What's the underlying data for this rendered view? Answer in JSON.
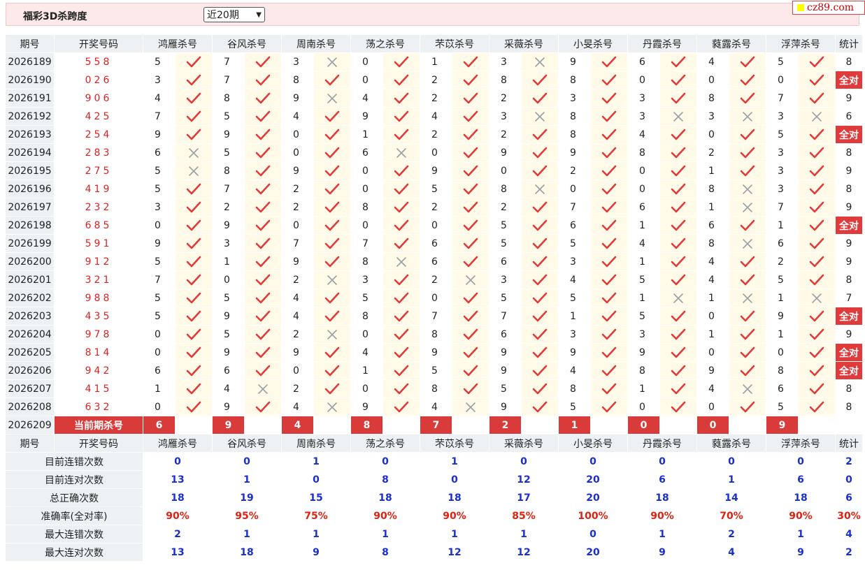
{
  "header": {
    "title": "福彩3D杀跨度",
    "period_selected": "近20期",
    "logo_text": "cz89.com"
  },
  "columns": {
    "issue": "期号",
    "numbers": "开奖号码",
    "experts": [
      "鸿雁杀号",
      "谷风杀号",
      "周南杀号",
      "荡之杀号",
      "芣苡杀号",
      "采薇杀号",
      "小旻杀号",
      "丹霞杀号",
      "蕤露杀号",
      "浮萍杀号"
    ],
    "stat": "统计"
  },
  "rows": [
    {
      "issue": "2026189",
      "numbers": "558",
      "kills": [
        [
          "5",
          1
        ],
        [
          "7",
          1
        ],
        [
          "3",
          0
        ],
        [
          "0",
          1
        ],
        [
          "1",
          1
        ],
        [
          "3",
          0
        ],
        [
          "9",
          1
        ],
        [
          "6",
          1
        ],
        [
          "4",
          1
        ],
        [
          "5",
          1
        ]
      ],
      "stat": "8"
    },
    {
      "issue": "2026190",
      "numbers": "026",
      "kills": [
        [
          "3",
          1
        ],
        [
          "7",
          1
        ],
        [
          "8",
          1
        ],
        [
          "0",
          1
        ],
        [
          "2",
          1
        ],
        [
          "8",
          1
        ],
        [
          "8",
          1
        ],
        [
          "0",
          1
        ],
        [
          "0",
          1
        ],
        [
          "0",
          1
        ]
      ],
      "stat": "全对"
    },
    {
      "issue": "2026191",
      "numbers": "906",
      "kills": [
        [
          "4",
          1
        ],
        [
          "8",
          1
        ],
        [
          "9",
          0
        ],
        [
          "4",
          1
        ],
        [
          "2",
          1
        ],
        [
          "2",
          1
        ],
        [
          "3",
          1
        ],
        [
          "3",
          1
        ],
        [
          "8",
          1
        ],
        [
          "7",
          1
        ]
      ],
      "stat": "9"
    },
    {
      "issue": "2026192",
      "numbers": "425",
      "kills": [
        [
          "7",
          1
        ],
        [
          "5",
          1
        ],
        [
          "4",
          1
        ],
        [
          "9",
          1
        ],
        [
          "4",
          1
        ],
        [
          "3",
          0
        ],
        [
          "8",
          1
        ],
        [
          "3",
          0
        ],
        [
          "3",
          0
        ],
        [
          "3",
          0
        ]
      ],
      "stat": "6"
    },
    {
      "issue": "2026193",
      "numbers": "254",
      "kills": [
        [
          "9",
          1
        ],
        [
          "9",
          1
        ],
        [
          "0",
          1
        ],
        [
          "1",
          1
        ],
        [
          "2",
          1
        ],
        [
          "2",
          1
        ],
        [
          "8",
          1
        ],
        [
          "4",
          1
        ],
        [
          "0",
          1
        ],
        [
          "5",
          1
        ]
      ],
      "stat": "全对"
    },
    {
      "issue": "2026194",
      "numbers": "283",
      "kills": [
        [
          "6",
          0
        ],
        [
          "5",
          1
        ],
        [
          "0",
          1
        ],
        [
          "6",
          0
        ],
        [
          "0",
          1
        ],
        [
          "9",
          1
        ],
        [
          "9",
          1
        ],
        [
          "8",
          1
        ],
        [
          "2",
          1
        ],
        [
          "3",
          1
        ]
      ],
      "stat": "8"
    },
    {
      "issue": "2026195",
      "numbers": "275",
      "kills": [
        [
          "5",
          0
        ],
        [
          "8",
          1
        ],
        [
          "9",
          1
        ],
        [
          "0",
          1
        ],
        [
          "9",
          1
        ],
        [
          "0",
          1
        ],
        [
          "2",
          1
        ],
        [
          "0",
          1
        ],
        [
          "1",
          1
        ],
        [
          "3",
          1
        ]
      ],
      "stat": "9"
    },
    {
      "issue": "2026196",
      "numbers": "419",
      "kills": [
        [
          "5",
          1
        ],
        [
          "7",
          1
        ],
        [
          "2",
          1
        ],
        [
          "0",
          1
        ],
        [
          "5",
          1
        ],
        [
          "8",
          0
        ],
        [
          "0",
          1
        ],
        [
          "0",
          1
        ],
        [
          "8",
          0
        ],
        [
          "3",
          1
        ]
      ],
      "stat": "8"
    },
    {
      "issue": "2026197",
      "numbers": "232",
      "kills": [
        [
          "3",
          1
        ],
        [
          "2",
          1
        ],
        [
          "2",
          1
        ],
        [
          "8",
          1
        ],
        [
          "2",
          1
        ],
        [
          "2",
          1
        ],
        [
          "7",
          1
        ],
        [
          "6",
          1
        ],
        [
          "1",
          0
        ],
        [
          "7",
          1
        ]
      ],
      "stat": "9"
    },
    {
      "issue": "2026198",
      "numbers": "685",
      "kills": [
        [
          "0",
          1
        ],
        [
          "9",
          1
        ],
        [
          "0",
          1
        ],
        [
          "0",
          1
        ],
        [
          "0",
          1
        ],
        [
          "5",
          1
        ],
        [
          "6",
          1
        ],
        [
          "1",
          1
        ],
        [
          "6",
          1
        ],
        [
          "1",
          1
        ]
      ],
      "stat": "全对"
    },
    {
      "issue": "2026199",
      "numbers": "591",
      "kills": [
        [
          "9",
          1
        ],
        [
          "3",
          1
        ],
        [
          "7",
          1
        ],
        [
          "7",
          1
        ],
        [
          "6",
          1
        ],
        [
          "5",
          1
        ],
        [
          "5",
          1
        ],
        [
          "4",
          1
        ],
        [
          "8",
          0
        ],
        [
          "6",
          1
        ]
      ],
      "stat": "9"
    },
    {
      "issue": "2026200",
      "numbers": "912",
      "kills": [
        [
          "5",
          1
        ],
        [
          "1",
          1
        ],
        [
          "9",
          1
        ],
        [
          "8",
          0
        ],
        [
          "6",
          1
        ],
        [
          "6",
          1
        ],
        [
          "3",
          1
        ],
        [
          "1",
          1
        ],
        [
          "4",
          1
        ],
        [
          "2",
          1
        ]
      ],
      "stat": "9"
    },
    {
      "issue": "2026201",
      "numbers": "321",
      "kills": [
        [
          "7",
          1
        ],
        [
          "0",
          1
        ],
        [
          "2",
          0
        ],
        [
          "3",
          1
        ],
        [
          "2",
          0
        ],
        [
          "3",
          1
        ],
        [
          "4",
          1
        ],
        [
          "5",
          1
        ],
        [
          "4",
          1
        ],
        [
          "5",
          1
        ]
      ],
      "stat": "8"
    },
    {
      "issue": "2026202",
      "numbers": "988",
      "kills": [
        [
          "5",
          1
        ],
        [
          "5",
          1
        ],
        [
          "4",
          1
        ],
        [
          "5",
          1
        ],
        [
          "0",
          1
        ],
        [
          "5",
          1
        ],
        [
          "5",
          1
        ],
        [
          "1",
          0
        ],
        [
          "1",
          0
        ],
        [
          "1",
          0
        ]
      ],
      "stat": "7"
    },
    {
      "issue": "2026203",
      "numbers": "435",
      "kills": [
        [
          "5",
          1
        ],
        [
          "9",
          1
        ],
        [
          "4",
          1
        ],
        [
          "8",
          1
        ],
        [
          "7",
          1
        ],
        [
          "7",
          1
        ],
        [
          "1",
          1
        ],
        [
          "5",
          1
        ],
        [
          "0",
          1
        ],
        [
          "9",
          1
        ]
      ],
      "stat": "全对"
    },
    {
      "issue": "2026204",
      "numbers": "978",
      "kills": [
        [
          "0",
          1
        ],
        [
          "5",
          1
        ],
        [
          "2",
          0
        ],
        [
          "0",
          1
        ],
        [
          "8",
          1
        ],
        [
          "6",
          1
        ],
        [
          "3",
          1
        ],
        [
          "3",
          1
        ],
        [
          "1",
          1
        ],
        [
          "1",
          1
        ]
      ],
      "stat": "9"
    },
    {
      "issue": "2026205",
      "numbers": "814",
      "kills": [
        [
          "0",
          1
        ],
        [
          "9",
          1
        ],
        [
          "9",
          1
        ],
        [
          "4",
          1
        ],
        [
          "9",
          1
        ],
        [
          "9",
          1
        ],
        [
          "9",
          1
        ],
        [
          "9",
          1
        ],
        [
          "0",
          1
        ],
        [
          "0",
          1
        ]
      ],
      "stat": "全对"
    },
    {
      "issue": "2026206",
      "numbers": "942",
      "kills": [
        [
          "6",
          1
        ],
        [
          "6",
          1
        ],
        [
          "0",
          1
        ],
        [
          "1",
          1
        ],
        [
          "5",
          1
        ],
        [
          "9",
          1
        ],
        [
          "4",
          1
        ],
        [
          "8",
          1
        ],
        [
          "9",
          1
        ],
        [
          "8",
          1
        ]
      ],
      "stat": "全对"
    },
    {
      "issue": "2026207",
      "numbers": "415",
      "kills": [
        [
          "1",
          1
        ],
        [
          "4",
          0
        ],
        [
          "2",
          1
        ],
        [
          "0",
          1
        ],
        [
          "8",
          1
        ],
        [
          "5",
          1
        ],
        [
          "8",
          1
        ],
        [
          "1",
          1
        ],
        [
          "4",
          0
        ],
        [
          "6",
          1
        ]
      ],
      "stat": "8"
    },
    {
      "issue": "2026208",
      "numbers": "632",
      "kills": [
        [
          "0",
          1
        ],
        [
          "9",
          1
        ],
        [
          "4",
          0
        ],
        [
          "9",
          1
        ],
        [
          "4",
          0
        ],
        [
          "9",
          1
        ],
        [
          "5",
          1
        ],
        [
          "0",
          1
        ],
        [
          "0",
          1
        ],
        [
          "5",
          1
        ]
      ],
      "stat": "8"
    }
  ],
  "current": {
    "issue": "2026209",
    "label": "当前期杀号",
    "kills": [
      "6",
      "9",
      "4",
      "8",
      "7",
      "2",
      "1",
      "0",
      "0",
      "9"
    ]
  },
  "summary": [
    {
      "label": "目前连错次数",
      "values": [
        "0",
        "0",
        "1",
        "0",
        "1",
        "0",
        "0",
        "0",
        "0",
        "0"
      ],
      "stat": "2",
      "kind": "val"
    },
    {
      "label": "目前连对次数",
      "values": [
        "13",
        "1",
        "0",
        "8",
        "0",
        "12",
        "20",
        "6",
        "1",
        "6"
      ],
      "stat": "0",
      "kind": "val"
    },
    {
      "label": "总正确次数",
      "values": [
        "18",
        "19",
        "15",
        "18",
        "18",
        "17",
        "20",
        "18",
        "14",
        "18"
      ],
      "stat": "6",
      "kind": "val"
    },
    {
      "label": "准确率(全对率)",
      "values": [
        "90%",
        "95%",
        "75%",
        "90%",
        "90%",
        "85%",
        "100%",
        "90%",
        "70%",
        "90%"
      ],
      "stat": "30%",
      "kind": "rate"
    },
    {
      "label": "最大连错次数",
      "values": [
        "2",
        "1",
        "1",
        "1",
        "1",
        "1",
        "0",
        "1",
        "2",
        "1"
      ],
      "stat": "4",
      "kind": "val"
    },
    {
      "label": "最大连对次数",
      "values": [
        "13",
        "18",
        "9",
        "8",
        "12",
        "12",
        "20",
        "9",
        "4",
        "9"
      ],
      "stat": "2",
      "kind": "val"
    }
  ],
  "icons": {
    "right": "check-icon",
    "wrong": "cross-icon"
  },
  "colors": {
    "accent_red": "#d93a3a",
    "blue_value": "#1a2fcc",
    "header_bg": "#eef1f3",
    "mark_bg": "#fffbe8"
  }
}
